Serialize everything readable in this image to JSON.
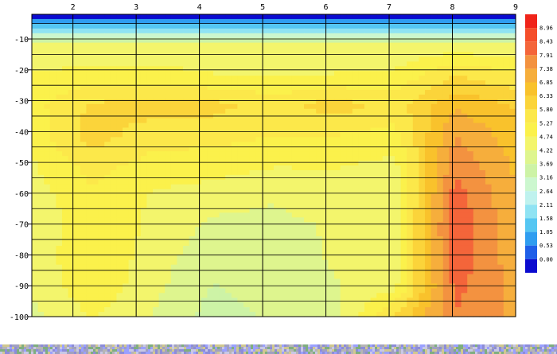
{
  "chart_data": {
    "type": "contour",
    "title": "",
    "xlabel": "",
    "ylabel": "",
    "x_ticks": [
      2,
      3,
      4,
      5,
      6,
      7,
      8,
      9
    ],
    "xlim": [
      1.35,
      9
    ],
    "y_ticks": [
      -10,
      -20,
      -30,
      -40,
      -50,
      -60,
      -70,
      -80,
      -90,
      -100
    ],
    "ylim": [
      -100,
      -2
    ],
    "grid": true,
    "legend_position": "right",
    "color_levels": [
      {
        "label": "0.00",
        "color": "#0b0bcf"
      },
      {
        "label": "0.53",
        "color": "#1f5fe8"
      },
      {
        "label": "1.05",
        "color": "#2f9df0"
      },
      {
        "label": "1.58",
        "color": "#55c6f2"
      },
      {
        "label": "2.11",
        "color": "#8fe3f3"
      },
      {
        "label": "2.64",
        "color": "#bff2ee"
      },
      {
        "label": "3.16",
        "color": "#ccf7cf"
      },
      {
        "label": "3.69",
        "color": "#cdf3a6"
      },
      {
        "label": "4.22",
        "color": "#def58e"
      },
      {
        "label": "4.74",
        "color": "#f3f56c"
      },
      {
        "label": "5.27",
        "color": "#fbf14b"
      },
      {
        "label": "5.80",
        "color": "#fce84a"
      },
      {
        "label": "6.33",
        "color": "#fbd43a"
      },
      {
        "label": "6.85",
        "color": "#f9c22c"
      },
      {
        "label": "7.38",
        "color": "#f6ae3c"
      },
      {
        "label": "7.91",
        "color": "#f39240"
      },
      {
        "label": "8.43",
        "color": "#f4653a"
      },
      {
        "label": "8.96",
        "color": "#f54e2a"
      },
      {
        "label": "",
        "color": "#f0241a"
      }
    ],
    "values": [
      [
        0.0,
        0.0,
        0.0,
        0.0,
        0.0,
        0.0,
        0.0,
        0.0,
        0.0
      ],
      [
        4.8,
        4.8,
        4.8,
        4.8,
        4.8,
        4.8,
        4.8,
        4.9,
        4.8
      ],
      [
        5.3,
        5.5,
        5.5,
        5.3,
        5.2,
        5.3,
        5.4,
        6.3,
        5.9
      ],
      [
        5.6,
        6.4,
        6.6,
        6.5,
        6.1,
        6.6,
        6.1,
        7.3,
        6.8
      ],
      [
        5.5,
        6.6,
        6.0,
        6.0,
        5.8,
        5.8,
        5.6,
        7.9,
        7.1
      ],
      [
        5.2,
        6.0,
        5.6,
        5.5,
        5.3,
        5.3,
        5.1,
        8.3,
        7.3
      ],
      [
        5.0,
        5.7,
        5.2,
        5.0,
        4.8,
        5.0,
        5.0,
        8.7,
        7.4
      ],
      [
        4.9,
        5.6,
        5.2,
        4.6,
        4.6,
        4.8,
        5.0,
        8.9,
        7.5
      ],
      [
        4.9,
        5.8,
        5.0,
        4.4,
        4.5,
        4.8,
        5.0,
        8.8,
        7.6
      ],
      [
        4.8,
        5.7,
        4.9,
        4.2,
        4.4,
        4.7,
        5.1,
        8.6,
        7.7
      ],
      [
        4.6,
        5.3,
        4.7,
        4.0,
        4.3,
        4.5,
        6.4,
        8.4,
        7.8
      ]
    ]
  }
}
